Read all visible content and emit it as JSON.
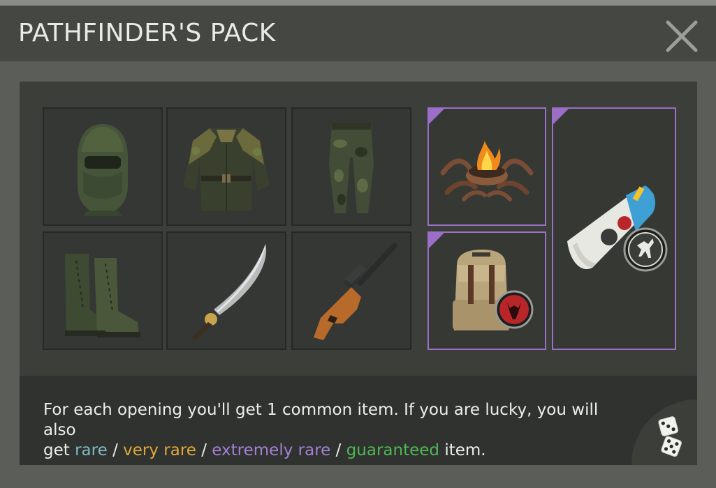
{
  "header": {
    "title": "PATHFINDER'S PACK"
  },
  "icons": {
    "close": "close-icon",
    "dice": "dice-icon"
  },
  "items": [
    {
      "name": "balaclava",
      "icon": "balaclava-icon",
      "rarity": "common"
    },
    {
      "name": "ghillie-jacket",
      "icon": "ghillie-jacket-icon",
      "rarity": "common"
    },
    {
      "name": "camo-pants",
      "icon": "camo-pants-icon",
      "rarity": "common"
    },
    {
      "name": "boots",
      "icon": "boots-icon",
      "rarity": "common"
    },
    {
      "name": "machete",
      "icon": "machete-icon",
      "rarity": "common"
    },
    {
      "name": "rifle",
      "icon": "rifle-icon",
      "rarity": "common"
    },
    {
      "name": "antler-brazier",
      "icon": "antler-brazier-icon",
      "rarity": "extremely_rare"
    },
    {
      "name": "backpack-skin",
      "icon": "backpack-icon",
      "rarity": "extremely_rare"
    },
    {
      "name": "moto-magazine",
      "icon": "magazine-icon",
      "rarity": "extremely_rare"
    }
  ],
  "colors": {
    "rare": "#7fb9c3",
    "very_rare": "#e0a73a",
    "extremely_rare": "#a37fd6",
    "guaranteed": "#4fb755"
  },
  "footer": {
    "text_line1": "For each opening you'll get 1 common item. If you are lucky, you will also",
    "text_get": "get",
    "rare": "rare",
    "sep1": "/",
    "very_rare": "very rare",
    "sep2": "/",
    "extremely_rare": "extremely rare",
    "sep3": "/",
    "guaranteed": "guaranteed",
    "text_end": "item."
  }
}
